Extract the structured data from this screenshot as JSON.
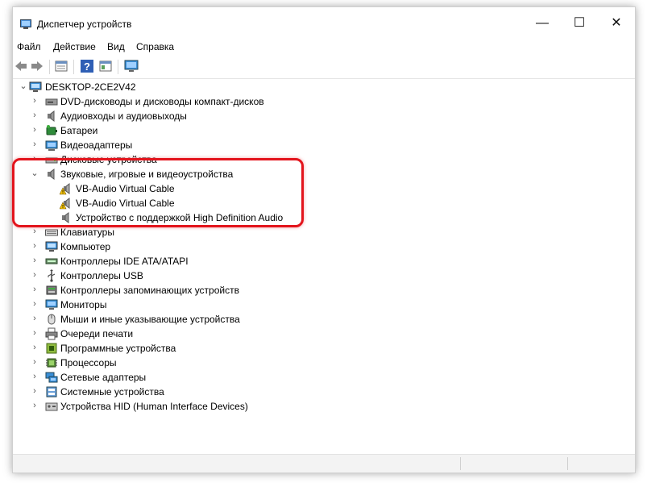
{
  "window": {
    "title": "Диспетчер устройств"
  },
  "title_buttons": {
    "minimize": "—",
    "maximize": "☐",
    "close": "✕"
  },
  "menu": [
    "Файл",
    "Действие",
    "Вид",
    "Справка"
  ],
  "toolbar_icons": [
    "back-icon",
    "forward-icon",
    "properties-icon",
    "help-icon",
    "update-icon",
    "monitor-icon"
  ],
  "tree": {
    "root": "DESKTOP-2CE2V42",
    "categories": [
      {
        "label": "DVD-дисководы и дисководы компакт-дисков",
        "icon": "dvd-icon"
      },
      {
        "label": "Аудиовходы и аудиовыходы",
        "icon": "speaker-icon"
      },
      {
        "label": "Батареи",
        "icon": "battery-icon"
      },
      {
        "label": "Видеоадаптеры",
        "icon": "display-adapter-icon"
      },
      {
        "label": "Дисковые устройства",
        "icon": "disk-drive-icon"
      },
      {
        "label": "Звуковые, игровые и видеоустройства",
        "icon": "speaker-icon",
        "expanded": true,
        "children": [
          {
            "label": "VB-Audio Virtual Cable",
            "icon": "speaker-warning-icon"
          },
          {
            "label": "VB-Audio Virtual Cable",
            "icon": "speaker-warning-icon"
          },
          {
            "label": "Устройство с поддержкой High Definition Audio",
            "icon": "speaker-icon"
          }
        ]
      },
      {
        "label": "Клавиатуры",
        "icon": "keyboard-icon"
      },
      {
        "label": "Компьютер",
        "icon": "computer-icon"
      },
      {
        "label": "Контроллеры IDE ATA/ATAPI",
        "icon": "ide-controller-icon"
      },
      {
        "label": "Контроллеры USB",
        "icon": "usb-icon"
      },
      {
        "label": "Контроллеры запоминающих устройств",
        "icon": "storage-controller-icon"
      },
      {
        "label": "Мониторы",
        "icon": "monitor-icon"
      },
      {
        "label": "Мыши и иные указывающие устройства",
        "icon": "mouse-icon"
      },
      {
        "label": "Очереди печати",
        "icon": "printer-icon"
      },
      {
        "label": "Программные устройства",
        "icon": "software-device-icon"
      },
      {
        "label": "Процессоры",
        "icon": "processor-icon"
      },
      {
        "label": "Сетевые адаптеры",
        "icon": "network-adapter-icon"
      },
      {
        "label": "Системные устройства",
        "icon": "system-device-icon"
      },
      {
        "label": "Устройства HID (Human Interface Devices)",
        "icon": "hid-icon"
      }
    ]
  },
  "colors": {
    "highlight": "#e3141c",
    "accent": "#1e73be"
  }
}
